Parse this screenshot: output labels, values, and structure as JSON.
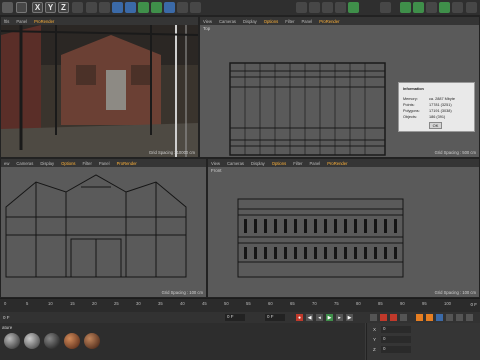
{
  "viewports": {
    "perspective": {
      "menu": [
        "ftls",
        "Panel",
        "ProRender"
      ],
      "grid_spacing": "Grid Spacing : 10000 cm"
    },
    "top": {
      "menu": [
        "View",
        "Cameras",
        "Display",
        "Options",
        "Filter",
        "Panel",
        "ProRender"
      ],
      "label": "Top",
      "grid_spacing": "Grid Spacing : 500 cm"
    },
    "right": {
      "menu": [
        "ew",
        "Cameras",
        "Display",
        "Options",
        "Filter",
        "Panel",
        "ProRender"
      ],
      "grid_spacing": "Grid Spacing : 100 cm"
    },
    "front": {
      "menu": [
        "View",
        "Cameras",
        "Display",
        "Options",
        "Filter",
        "Panel",
        "ProRender"
      ],
      "label": "Front",
      "grid_spacing": "Grid Spacing : 100 cm"
    }
  },
  "info_dialog": {
    "title": "Information",
    "rows": [
      {
        "label": "Memory:",
        "value": "ca. 2887 Mbyte"
      },
      {
        "label": "Points:",
        "value": "17781 (3251)"
      },
      {
        "label": "Polygons:",
        "value": "17191 (3038)"
      },
      {
        "label": "Objects:",
        "value": "186 (391)"
      }
    ],
    "ok": "OK"
  },
  "timeline": {
    "ticks": [
      "0",
      "5",
      "10",
      "15",
      "20",
      "25",
      "30",
      "35",
      "40",
      "45",
      "50",
      "55",
      "60",
      "65",
      "70",
      "75",
      "80",
      "85",
      "90",
      "95",
      "100"
    ],
    "frame_end": "0 F"
  },
  "transport": {
    "frame_start": "0 F",
    "frame_min": "0 F",
    "frame_max": "0 F"
  },
  "materials": {
    "label": "ature"
  },
  "attributes": {
    "row_labels": [
      "X",
      "Y",
      "Z"
    ],
    "row_values": [
      "0",
      "0",
      "0"
    ]
  },
  "colors": {
    "accent": "#ffb23a",
    "green": "#3f8f4a",
    "blue": "#3b6aa8"
  }
}
